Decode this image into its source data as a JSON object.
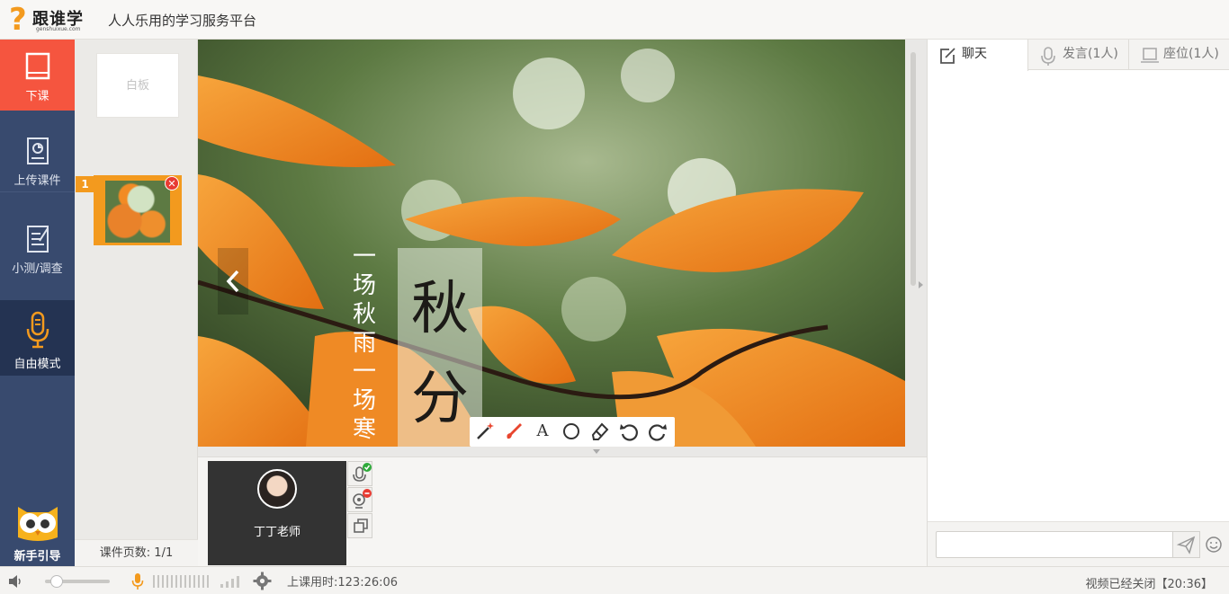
{
  "header": {
    "logo_text": "跟谁学",
    "logo_url": "genshuixue.com",
    "slogan": "人人乐用的学习服务平台"
  },
  "leftnav": {
    "end_class": "下课",
    "upload": "上传课件",
    "quiz": "小测/调查",
    "free_mode": "自由模式",
    "guide": "新手引导"
  },
  "slides": {
    "whiteboard": "白板",
    "thumb_number": "1",
    "page_count": "课件页数: 1/1"
  },
  "slide_text": {
    "vertical_poem": [
      "一",
      "场",
      "秋",
      "雨",
      "一",
      "场",
      "寒"
    ],
    "title_chars": [
      "秋",
      "分"
    ]
  },
  "toolbar": {
    "tools": [
      "wand-icon",
      "brush-icon",
      "text-icon",
      "circle-icon",
      "eraser-icon",
      "undo-icon",
      "redo-icon"
    ],
    "text_glyph": "A"
  },
  "video": {
    "teacher_name": "丁丁老师"
  },
  "rightpanel": {
    "tab_chat": "聊天",
    "tab_speak": "发言(1人)",
    "tab_seat": "座位(1人)"
  },
  "bottombar": {
    "class_time": "上课用时:123:26:06",
    "video_status": "视频已经关闭【20:36】"
  },
  "colors": {
    "accent_orange": "#f39a1e",
    "end_class_red": "#f5553f",
    "nav_blue": "#384a6e"
  }
}
